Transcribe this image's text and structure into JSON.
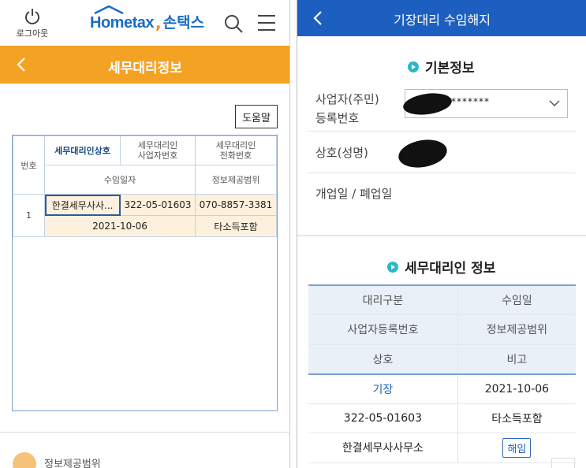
{
  "left": {
    "header": {
      "logout_label": "로그아웃",
      "brand_home": "Hometax",
      "brand_korean": "손택스"
    },
    "title_bar": {
      "title": "세무대리정보"
    },
    "help_button": "도움말",
    "table": {
      "headers": {
        "number": "번호",
        "agent_name": "세무대리인상호",
        "agent_biz_no": "세무대리인\n사업자번호",
        "agent_phone": "세무대리인\n전화번호",
        "appointment_date": "수임일자",
        "info_scope": "정보제공범위"
      },
      "rows": [
        {
          "number": "1",
          "agent_name": "한결세무사사...",
          "agent_biz_no": "322-05-01603",
          "agent_phone": "070-8857-3381",
          "appointment_date": "2021-10-06",
          "info_scope": "타소득포함"
        }
      ]
    },
    "footer_text": "정보제공범위"
  },
  "right": {
    "title_bar": {
      "title": "기장대리 수임해지"
    },
    "basic_info": {
      "section_title": "기본정보",
      "biz_reg_label_1": "사업자(주민)",
      "biz_reg_label_2": "등록번호",
      "biz_reg_value": "*******",
      "name_label": "상호(성명)",
      "open_close_label": "개업일 / 폐업일"
    },
    "agent_info": {
      "section_title": "세무대리인 정보",
      "header_rows": [
        [
          "대리구분",
          "수임일"
        ],
        [
          "사업자등록번호",
          "정보제공범위"
        ],
        [
          "상호",
          "비고"
        ]
      ],
      "value_rows": [
        [
          "기장",
          "2021-10-06"
        ],
        [
          "322-05-01603",
          "타소득포함"
        ],
        [
          "한결세무사사무소",
          "해임"
        ]
      ]
    }
  },
  "colors": {
    "orange_bar": "#f4a224",
    "blue_bar": "#1d5fc1",
    "brand_blue": "#1a6cc6",
    "accent_cyan": "#2bb7c9"
  }
}
